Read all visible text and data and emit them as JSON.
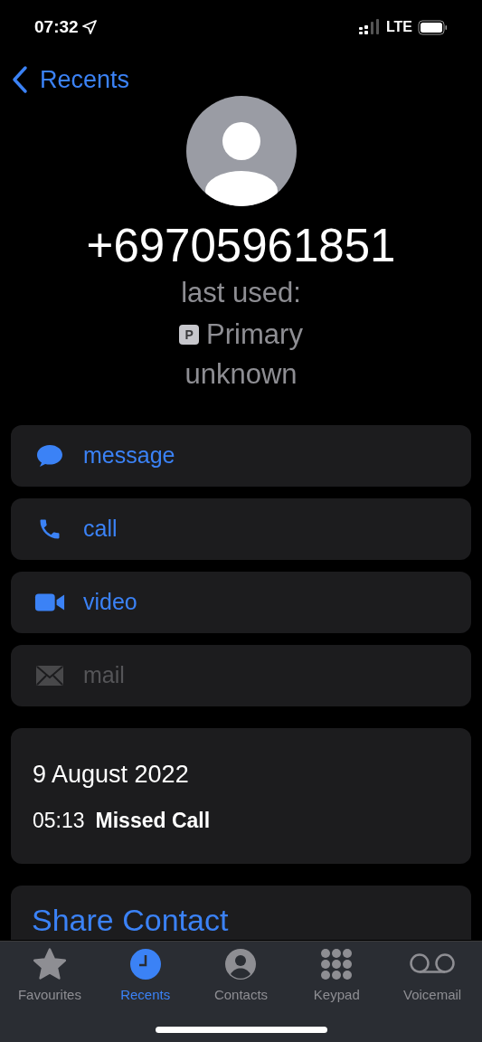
{
  "status_bar": {
    "time": "07:32",
    "network": "LTE"
  },
  "nav": {
    "back_label": "Recents"
  },
  "contact": {
    "number": "+69705961851",
    "last_used_label": "last used:",
    "line_badge": "P",
    "line_name": "Primary",
    "location": "unknown"
  },
  "actions": [
    {
      "kind": "message",
      "label": "message",
      "disabled": false
    },
    {
      "kind": "call",
      "label": "call",
      "disabled": false
    },
    {
      "kind": "video",
      "label": "video",
      "disabled": false
    },
    {
      "kind": "mail",
      "label": "mail",
      "disabled": true
    }
  ],
  "call_log": {
    "date": "9 August 2022",
    "entries": [
      {
        "time": "05:13",
        "type": "Missed Call"
      }
    ]
  },
  "share_contact": {
    "label": "Share Contact"
  },
  "tab_bar": [
    {
      "kind": "favourites",
      "label": "Favourites",
      "selected": false
    },
    {
      "kind": "recents",
      "label": "Recents",
      "selected": true
    },
    {
      "kind": "contacts",
      "label": "Contacts",
      "selected": false
    },
    {
      "kind": "keypad",
      "label": "Keypad",
      "selected": false
    },
    {
      "kind": "voicemail",
      "label": "Voicemail",
      "selected": false
    }
  ]
}
